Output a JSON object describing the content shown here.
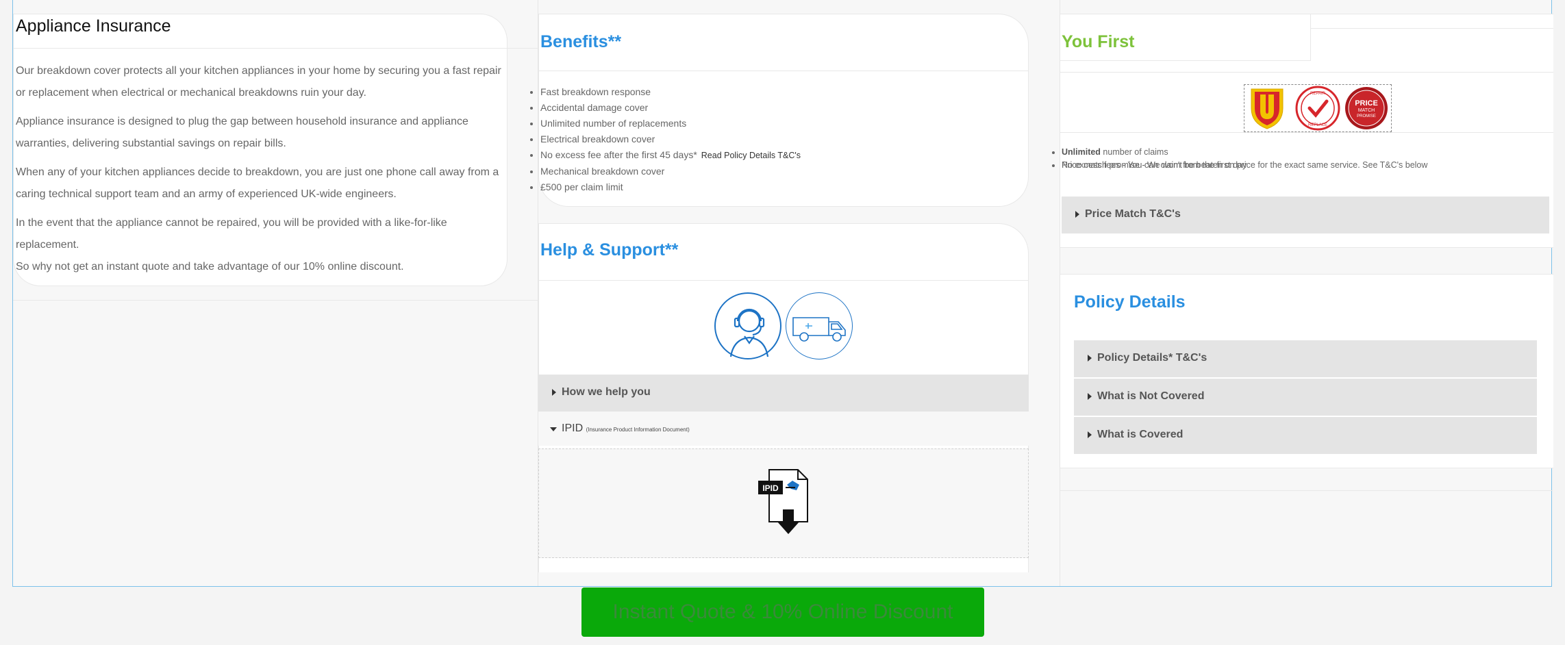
{
  "intro": {
    "title": "Appliance Insurance",
    "paragraphs": [
      "Our breakdown cover protects all your kitchen appliances in your home by securing you a  fast repair or replacement when electrical or mechanical breakdowns ruin your day.",
      "Appliance insurance is designed to plug the gap between household insurance and appliance warranties, delivering substantial savings on repair bills.",
      "When any of your kitchen appliances decide to breakdown, you are just one phone call away from a caring technical support team and an army of experienced UK-wide engineers.",
      "In the event that the appliance cannot be repaired, you will be provided with a like-for-like replacement.",
      "So why not get an instant quote and take advantage of our 10% online discount."
    ]
  },
  "benefits": {
    "title": "Benefits**",
    "items": [
      "Fast breakdown response",
      "Accidental damage cover",
      "Unlimited number of replacements",
      "Electrical breakdown cover",
      "No excess fee after the first 45 days*",
      "Mechanical breakdown cover",
      "£500 per claim limit"
    ],
    "tc_link": "Read Policy Details T&C's"
  },
  "help": {
    "title": "Help & Support**",
    "how_label": "How we help you",
    "ipid_label": "IPID",
    "ipid_sub": "(Insurance Product Information Document)",
    "ipid_icon_text": "IPID"
  },
  "youfirst": {
    "title": "You First",
    "badges": [
      "U",
      "REPAIR REPLACE",
      "PRICE MATCH PROMISE"
    ],
    "unlimited_bold": "Unlimited",
    "unlimited_rest": " number of claims",
    "overlap_a": "No excess fees - You can claim from the first day",
    "overlap_b": "Price match promise - We won't be beaten on price for the exact same service. See T&C's below",
    "price_label": "Price Match T&C's"
  },
  "policy": {
    "title": "Policy Details",
    "items": [
      "Policy Details* T&C's",
      "What is Not Covered",
      "What is Covered"
    ]
  },
  "cta": {
    "label": "Instant Quote & 10% Online Discount"
  },
  "colors": {
    "accent_blue": "#2a8fe0",
    "accent_green": "#7dc23b",
    "cta_green": "#0aa90a",
    "badge_red": "#d7262b"
  }
}
